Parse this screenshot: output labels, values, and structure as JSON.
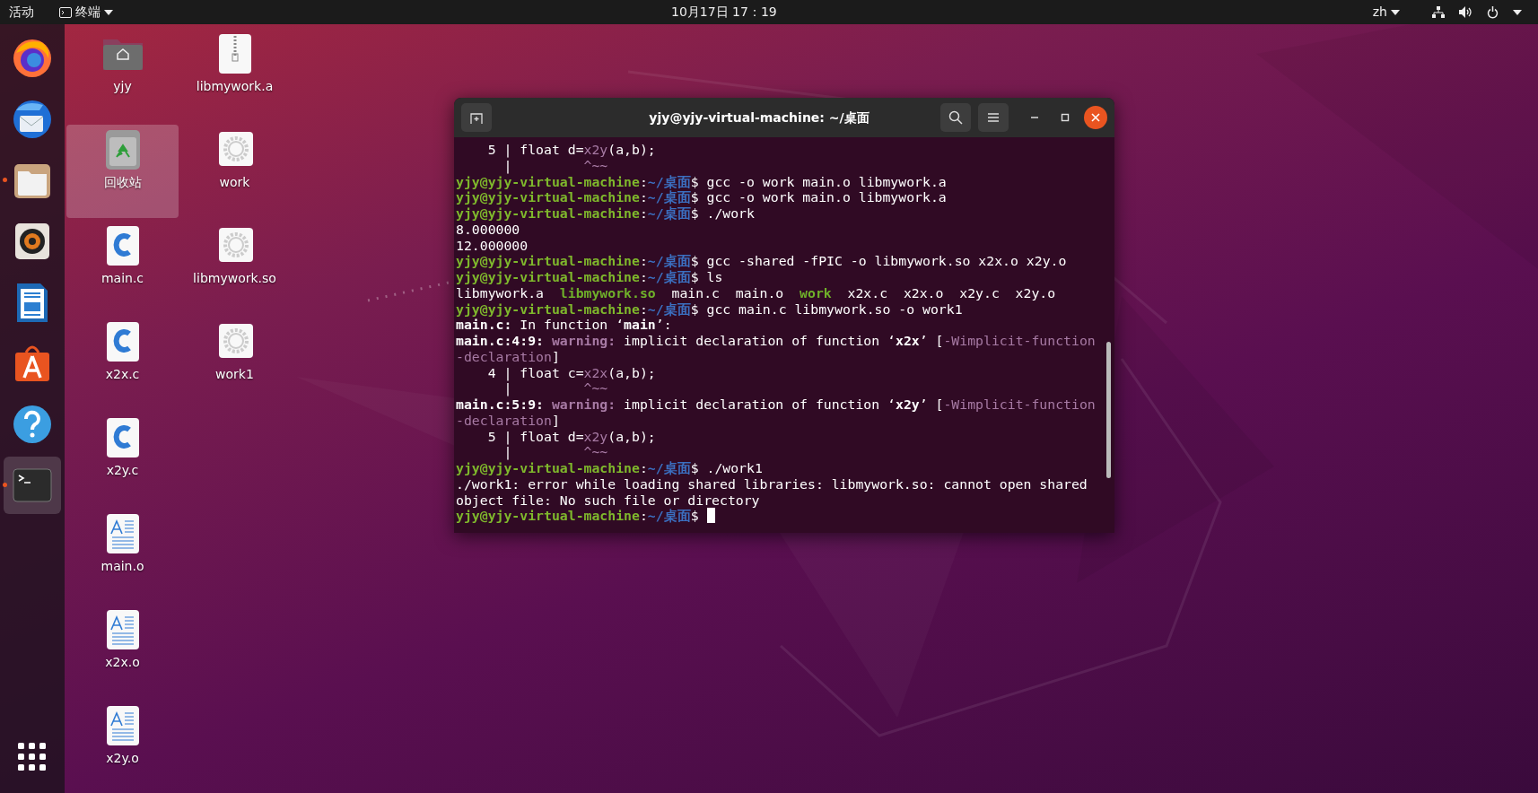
{
  "top_bar": {
    "activities": "活动",
    "app_menu": "终端",
    "clock": "10月17日 17：19",
    "input_method": "zh"
  },
  "dock": [
    {
      "running": false,
      "selected": false
    },
    {
      "running": false,
      "selected": false
    },
    {
      "running": true,
      "selected": false
    },
    {
      "running": false,
      "selected": false
    },
    {
      "running": false,
      "selected": false
    },
    {
      "running": false,
      "selected": false
    },
    {
      "running": false,
      "selected": false
    },
    {
      "running": true,
      "selected": true
    }
  ],
  "desktop_icons": [
    {
      "label": "yjy",
      "kind": "folder",
      "selected": false
    },
    {
      "label": "回收站",
      "kind": "trash",
      "selected": true
    },
    {
      "label": "main.c",
      "kind": "c-source",
      "selected": false
    },
    {
      "label": "x2x.c",
      "kind": "c-source",
      "selected": false
    },
    {
      "label": "x2y.c",
      "kind": "c-source",
      "selected": false
    },
    {
      "label": "main.o",
      "kind": "object",
      "selected": false
    },
    {
      "label": "x2x.o",
      "kind": "object",
      "selected": false
    },
    {
      "label": "x2y.o",
      "kind": "object",
      "selected": false
    },
    {
      "label": "libmywork.a",
      "kind": "archive",
      "selected": false
    },
    {
      "label": "work",
      "kind": "executable",
      "selected": false
    },
    {
      "label": "libmywork.so",
      "kind": "executable",
      "selected": false
    },
    {
      "label": "work1",
      "kind": "executable",
      "selected": false
    }
  ],
  "terminal": {
    "title": "yjy@yjy-virtual-machine: ~/桌面",
    "cursor": true,
    "lines": [
      [
        {
          "text": "    5 | float d=",
          "kind": "plain"
        },
        {
          "text": "x2y",
          "kind": "warning"
        },
        {
          "text": "(a,b);",
          "kind": "plain"
        }
      ],
      [
        {
          "text": "      |         ",
          "kind": "plain"
        },
        {
          "text": "^~~",
          "kind": "warning"
        }
      ],
      [
        {
          "text": "yjy@yjy-virtual-machine",
          "kind": "user"
        },
        {
          "text": ":",
          "kind": "plain"
        },
        {
          "text": "~/桌面",
          "kind": "path"
        },
        {
          "text": "$ gcc -o work main.o libmywork.a",
          "kind": "plain"
        }
      ],
      [
        {
          "text": "yjy@yjy-virtual-machine",
          "kind": "user"
        },
        {
          "text": ":",
          "kind": "plain"
        },
        {
          "text": "~/桌面",
          "kind": "path"
        },
        {
          "text": "$ gcc -o work main.o libmywork.a",
          "kind": "plain"
        }
      ],
      [
        {
          "text": "yjy@yjy-virtual-machine",
          "kind": "user"
        },
        {
          "text": ":",
          "kind": "plain"
        },
        {
          "text": "~/桌面",
          "kind": "path"
        },
        {
          "text": "$ ./work",
          "kind": "plain"
        }
      ],
      [
        {
          "text": "8.000000",
          "kind": "plain"
        }
      ],
      [
        {
          "text": "12.000000",
          "kind": "plain"
        }
      ],
      [
        {
          "text": "yjy@yjy-virtual-machine",
          "kind": "user"
        },
        {
          "text": ":",
          "kind": "plain"
        },
        {
          "text": "~/桌面",
          "kind": "path"
        },
        {
          "text": "$ gcc -shared -fPIC -o libmywork.so x2x.o x2y.o",
          "kind": "plain"
        }
      ],
      [
        {
          "text": "yjy@yjy-virtual-machine",
          "kind": "user"
        },
        {
          "text": ":",
          "kind": "plain"
        },
        {
          "text": "~/桌面",
          "kind": "path"
        },
        {
          "text": "$ ls",
          "kind": "plain"
        }
      ],
      [
        {
          "text": "libmywork.a  ",
          "kind": "plain"
        },
        {
          "text": "libmywork.so",
          "kind": "exec"
        },
        {
          "text": "  main.c  main.o  ",
          "kind": "plain"
        },
        {
          "text": "work",
          "kind": "exec"
        },
        {
          "text": "  x2x.c  x2x.o  x2y.c  x2y.o",
          "kind": "plain"
        }
      ],
      [
        {
          "text": "yjy@yjy-virtual-machine",
          "kind": "user"
        },
        {
          "text": ":",
          "kind": "plain"
        },
        {
          "text": "~/桌面",
          "kind": "path"
        },
        {
          "text": "$ gcc main.c libmywork.so -o work1",
          "kind": "plain"
        }
      ],
      [
        {
          "text": "main.c:",
          "kind": "bold"
        },
        {
          "text": " In function ‘",
          "kind": "plain"
        },
        {
          "text": "main",
          "kind": "bold"
        },
        {
          "text": "’:",
          "kind": "plain"
        }
      ],
      [
        {
          "text": "main.c:4:9:",
          "kind": "bold"
        },
        {
          "text": " warning:",
          "kind": "warning-bold"
        },
        {
          "text": " implicit declaration of function ‘",
          "kind": "plain"
        },
        {
          "text": "x2x",
          "kind": "bold"
        },
        {
          "text": "’ [",
          "kind": "plain"
        },
        {
          "text": "-Wimplicit-function",
          "kind": "warning"
        }
      ],
      [
        {
          "text": "-declaration",
          "kind": "warning"
        },
        {
          "text": "]",
          "kind": "plain"
        }
      ],
      [
        {
          "text": "    4 | float c=",
          "kind": "plain"
        },
        {
          "text": "x2x",
          "kind": "warning"
        },
        {
          "text": "(a,b);",
          "kind": "plain"
        }
      ],
      [
        {
          "text": "      |         ",
          "kind": "plain"
        },
        {
          "text": "^~~",
          "kind": "warning"
        }
      ],
      [
        {
          "text": "main.c:5:9:",
          "kind": "bold"
        },
        {
          "text": " warning:",
          "kind": "warning-bold"
        },
        {
          "text": " implicit declaration of function ‘",
          "kind": "plain"
        },
        {
          "text": "x2y",
          "kind": "bold"
        },
        {
          "text": "’ [",
          "kind": "plain"
        },
        {
          "text": "-Wimplicit-function",
          "kind": "warning"
        }
      ],
      [
        {
          "text": "-declaration",
          "kind": "warning"
        },
        {
          "text": "]",
          "kind": "plain"
        }
      ],
      [
        {
          "text": "    5 | float d=",
          "kind": "plain"
        },
        {
          "text": "x2y",
          "kind": "warning"
        },
        {
          "text": "(a,b);",
          "kind": "plain"
        }
      ],
      [
        {
          "text": "      |         ",
          "kind": "plain"
        },
        {
          "text": "^~~",
          "kind": "warning"
        }
      ],
      [
        {
          "text": "yjy@yjy-virtual-machine",
          "kind": "user"
        },
        {
          "text": ":",
          "kind": "plain"
        },
        {
          "text": "~/桌面",
          "kind": "path"
        },
        {
          "text": "$ ./work1",
          "kind": "plain"
        }
      ],
      [
        {
          "text": "./work1: error while loading shared libraries: libmywork.so: cannot open shared",
          "kind": "plain"
        }
      ],
      [
        {
          "text": "object file: No such file or directory",
          "kind": "plain"
        }
      ],
      [
        {
          "text": "yjy@yjy-virtual-machine",
          "kind": "user"
        },
        {
          "text": ":",
          "kind": "plain"
        },
        {
          "text": "~/桌面",
          "kind": "path"
        },
        {
          "text": "$",
          "kind": "plain"
        }
      ]
    ]
  }
}
